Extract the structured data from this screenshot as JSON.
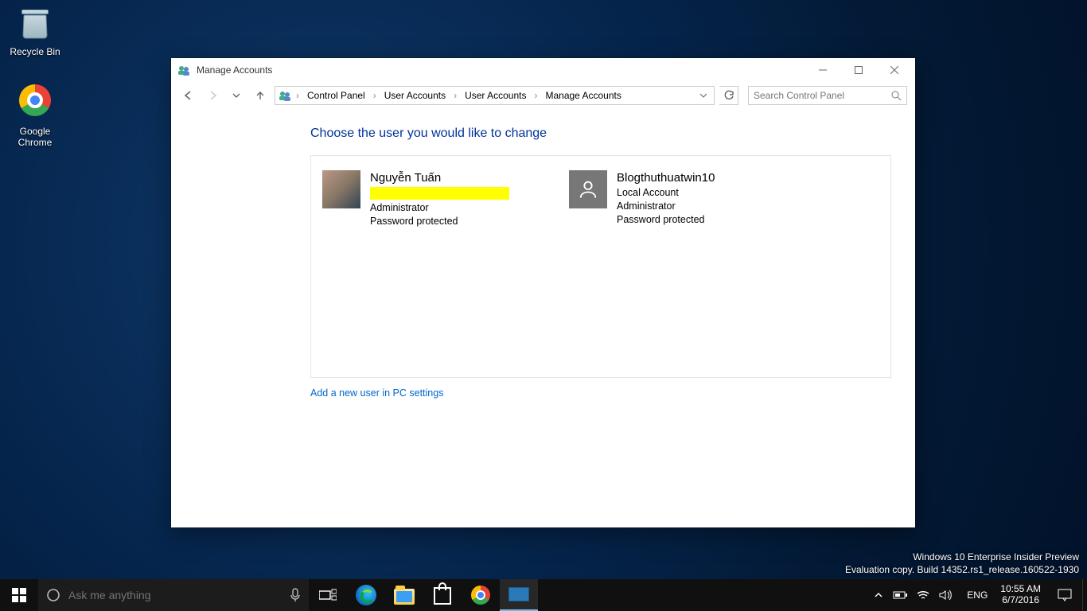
{
  "desktop": {
    "recycle_bin": "Recycle Bin",
    "chrome": "Google Chrome"
  },
  "window": {
    "title": "Manage Accounts",
    "breadcrumbs": [
      "Control Panel",
      "User Accounts",
      "User Accounts",
      "Manage Accounts"
    ],
    "search_placeholder": "Search Control Panel"
  },
  "page": {
    "heading": "Choose the user you would like to change",
    "add_link": "Add a new user in PC settings",
    "accounts": [
      {
        "name": "Nguyễn Tuấn",
        "redacted": true,
        "role": "Administrator",
        "pw": "Password protected",
        "avatar": "photo"
      },
      {
        "name": "Blogthuthuatwin10",
        "type": "Local Account",
        "role": "Administrator",
        "pw": "Password protected",
        "avatar": "generic"
      }
    ]
  },
  "watermark": {
    "line1": "Windows 10 Enterprise Insider Preview",
    "line2": "Evaluation copy. Build 14352.rs1_release.160522-1930"
  },
  "taskbar": {
    "search_placeholder": "Ask me anything",
    "lang": "ENG",
    "time": "10:55 AM",
    "date": "6/7/2016"
  }
}
